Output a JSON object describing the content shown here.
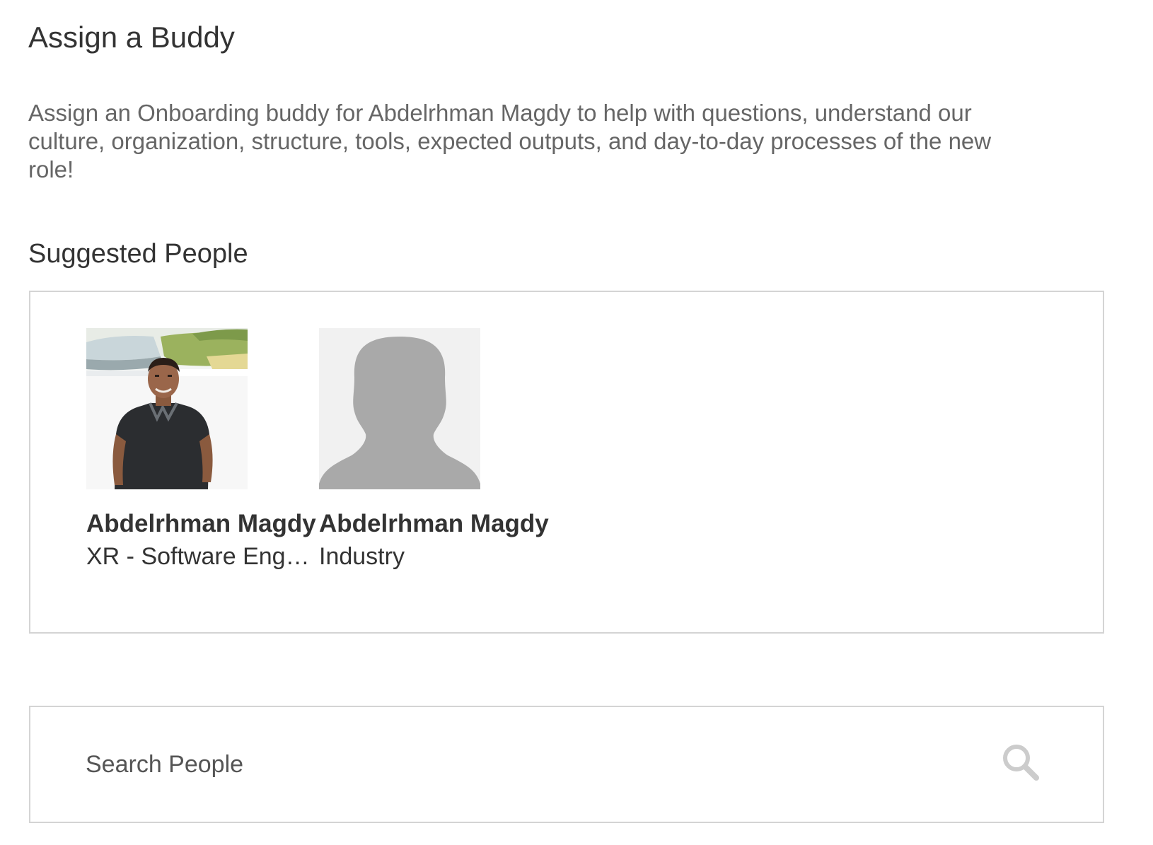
{
  "page": {
    "title": "Assign a Buddy",
    "description": "Assign an Onboarding buddy for Abdelrhman Magdy to help with questions, understand our culture, organization, structure, tools, expected outputs, and day-to-day processes of the new role!"
  },
  "suggested": {
    "title": "Suggested People",
    "people": [
      {
        "name": "Abdelrhman Magdy",
        "role": "XR - Software Eng…",
        "avatar": "person-photo"
      },
      {
        "name": "Abdelrhman Magdy",
        "role": "Industry",
        "avatar": "default-silhouette-icon"
      }
    ]
  },
  "search": {
    "placeholder": "Search People",
    "icon": "search-icon"
  },
  "colors": {
    "heading": "#333333",
    "description": "#666666",
    "border": "#d4d4d4",
    "silhouette_bg": "#f1f1f1",
    "silhouette_fg": "#a9a9a9",
    "search_icon": "#cccccc"
  }
}
